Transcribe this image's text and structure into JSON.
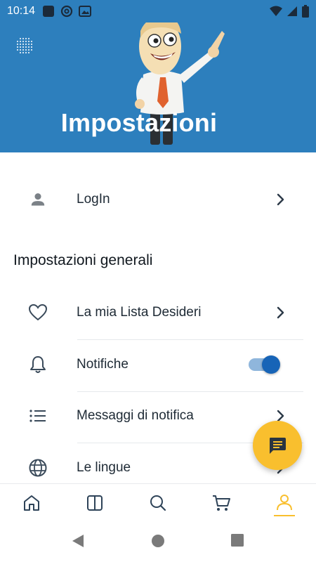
{
  "status_bar": {
    "time": "10:14",
    "left_icons": [
      "square-notification-icon",
      "at-notification-icon",
      "image-notification-icon"
    ],
    "right_icons": [
      "wifi-icon",
      "cell-signal-icon",
      "battery-icon"
    ]
  },
  "header": {
    "title": "Impostazioni",
    "background_color": "#2d7fbd",
    "logo_icon": "dotted-brand-logo",
    "illustration": "pointing-man-mascot"
  },
  "account": {
    "login_label": "LogIn",
    "icon": "person-icon"
  },
  "general_settings": {
    "section_title": "Impostazioni generali",
    "items": [
      {
        "label": "La mia Lista Desideri",
        "icon": "heart-icon",
        "control": "chevron"
      },
      {
        "label": "Notifiche",
        "icon": "bell-icon",
        "control": "toggle",
        "toggle_on": true
      },
      {
        "label": "Messaggi di notifica",
        "icon": "list-icon",
        "control": "chevron"
      },
      {
        "label": "Le lingue",
        "icon": "globe-icon",
        "control": "chevron"
      }
    ]
  },
  "fab": {
    "icon": "chat-message-icon",
    "color": "#f9bf2e"
  },
  "bottom_nav": {
    "items": [
      {
        "icon": "home-icon",
        "active": false
      },
      {
        "icon": "book-icon",
        "active": false
      },
      {
        "icon": "search-icon",
        "active": false
      },
      {
        "icon": "cart-icon",
        "active": false
      },
      {
        "icon": "profile-icon",
        "active": true
      }
    ],
    "active_color": "#f9bf2e"
  },
  "system_nav": [
    "back-icon",
    "home-circle-icon",
    "recents-icon"
  ]
}
